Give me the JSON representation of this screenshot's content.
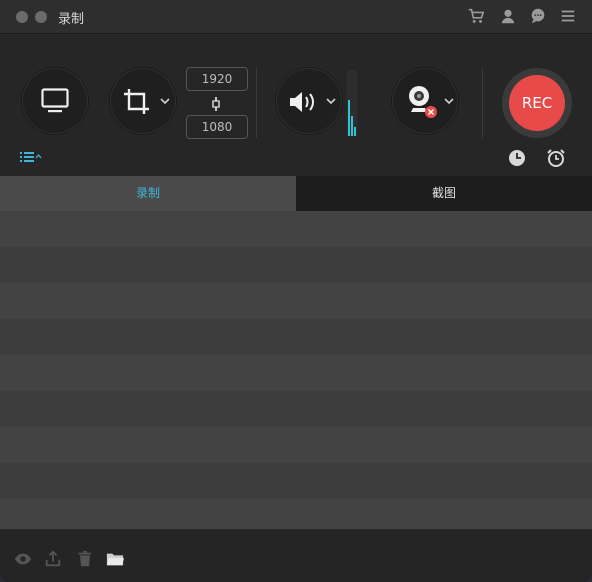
{
  "window": {
    "title": "录制"
  },
  "titlebar": {
    "icons": [
      "cart-icon",
      "user-icon",
      "chat-icon",
      "menu-icon"
    ]
  },
  "toolbar": {
    "resolution": {
      "width": "1920",
      "height": "1080"
    },
    "rec_label": "REC",
    "audio_level": 0.55
  },
  "tabs": {
    "record": "录制",
    "screenshot": "截图"
  },
  "colors": {
    "accent": "#3fb6d8",
    "rec": "#e84a4a"
  },
  "footer": {
    "icons": [
      "preview-icon",
      "share-icon",
      "delete-icon",
      "folder-icon"
    ]
  }
}
